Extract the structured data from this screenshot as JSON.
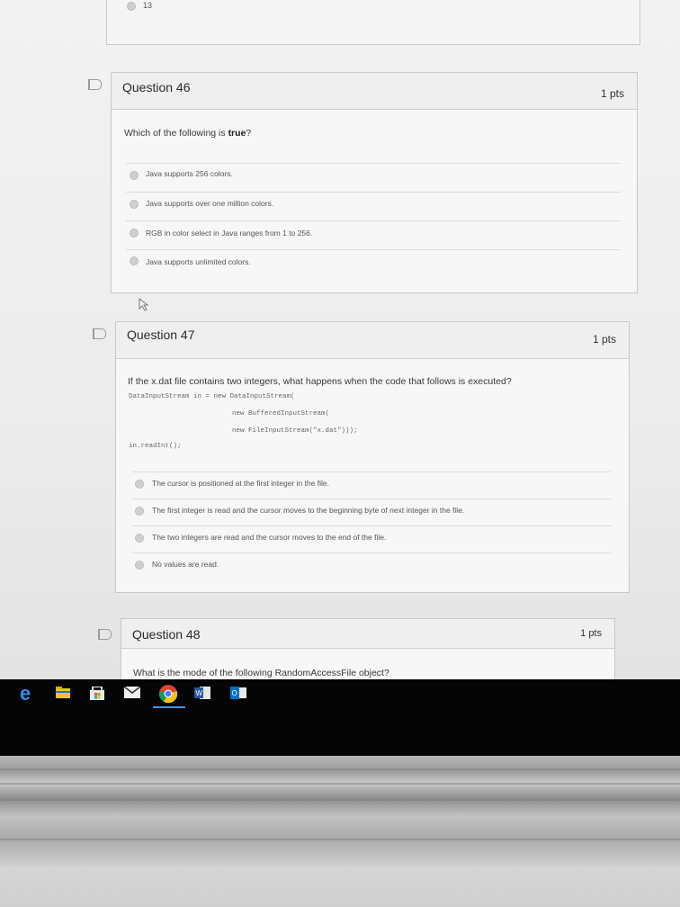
{
  "prev_question": {
    "last_option": "13"
  },
  "questions": [
    {
      "title": "Question 46",
      "points": "1 pts",
      "prompt_pre": "Which of the following is ",
      "prompt_bold": "true",
      "prompt_post": "?",
      "options": [
        "Java supports 256 colors.",
        "Java supports over one million colors.",
        "RGB in color select in Java ranges from 1 to 256.",
        "Java supports unlimited colors."
      ]
    },
    {
      "title": "Question 47",
      "points": "1 pts",
      "prompt": "If the x.dat file contains two integers, what happens when the code that follows is executed?",
      "code": [
        "DataInputStream in = new DataInputStream(",
        "new BufferedInputStream(",
        "new FileInputStream(\"x.dat\")));",
        "in.readInt();"
      ],
      "options": [
        "The cursor is positioned at the first integer in the file.",
        "The first integer is read and the cursor moves to the beginning byte of next integer in the file.",
        "The two integers are read and the cursor moves to the end of the file.",
        "No values are read."
      ]
    },
    {
      "title": "Question 48",
      "points": "1 pts",
      "prompt": "What is the mode of the following RandomAccessFile object?"
    }
  ],
  "taskbar": {
    "icons": [
      "edge-icon",
      "file-explorer-icon",
      "store-icon",
      "mail-icon",
      "chrome-icon",
      "word-icon",
      "outlook-icon"
    ]
  }
}
